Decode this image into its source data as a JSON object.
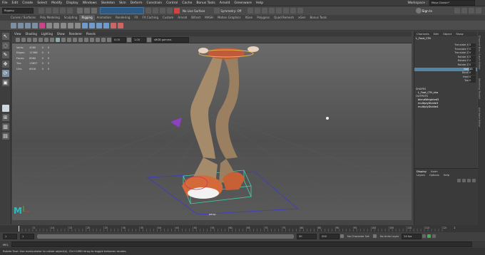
{
  "menubar": {
    "items": [
      "File",
      "Edit",
      "Create",
      "Select",
      "Modify",
      "Display",
      "Windows",
      "Skeleton",
      "Skin",
      "Deform",
      "Constrain",
      "Control",
      "Cache",
      "Bonus Tools",
      "Arnold",
      "Greenware",
      "Help"
    ],
    "workspace_label": "Workspace :",
    "workspace_value": "Maya Classic*"
  },
  "toolbar": {
    "mode_select": "Rigging",
    "no_live_surface": "No Live Surface",
    "symmetry": "Symmetry: Off",
    "sign_in": "Sign In",
    "search_placeholder": ""
  },
  "shelf_tabs": [
    "Curves / Surfaces",
    "Poly Modeling",
    "Sculpting",
    "Rigging",
    "Animation",
    "Rendering",
    "FX",
    "FX Caching",
    "Custom",
    "Arnold",
    "Bifrost",
    "MASH",
    "Motion Graphics",
    "XGen",
    "Polygons",
    "Quad Remesh",
    "xGen",
    "Bonus Tools"
  ],
  "shelf_active_index": 3,
  "viewport": {
    "menu": [
      "View",
      "Shading",
      "Lighting",
      "Show",
      "Renderer",
      "Panels"
    ],
    "near_value": "0.00",
    "far_value": "1.00",
    "color_space": "sRGB gamma",
    "camera_label": "persp",
    "hud": [
      {
        "label": "Verts:",
        "v1": "4560",
        "v2": "0",
        "v3": "0"
      },
      {
        "label": "Edges:",
        "v1": "11566",
        "v2": "0",
        "v3": "0"
      },
      {
        "label": "Faces:",
        "v1": "6560",
        "v2": "0",
        "v3": "0"
      },
      {
        "label": "Tris:",
        "v1": "13657",
        "v2": "0",
        "v3": "0"
      },
      {
        "label": "UVs:",
        "v1": "6916",
        "v2": "0",
        "v3": "0"
      }
    ]
  },
  "channel_box": {
    "tabs": [
      "Channels",
      "Edit",
      "Object",
      "Show"
    ],
    "object_name": "L_Foot_CTrl",
    "attributes": [
      {
        "name": "Translate X",
        "value": "0"
      },
      {
        "name": "Translate Y",
        "value": "0"
      },
      {
        "name": "Translate Z",
        "value": "0"
      },
      {
        "name": "Rotate X",
        "value": "0"
      },
      {
        "name": "Rotate Y",
        "value": "0"
      },
      {
        "name": "Rotate Z",
        "value": "0"
      },
      {
        "name": "Ball",
        "value": "10"
      },
      {
        "name": "Bank",
        "value": "0"
      },
      {
        "name": "Heel",
        "value": "0"
      },
      {
        "name": "Toe",
        "value": "0"
      }
    ],
    "selected_index": 6,
    "shapes_header": "SHAPES",
    "shape_name": "L_Foot_CTrl_sha",
    "outputs_header": "OUTPUTS",
    "outputs": [
      "blendWeighted3",
      "multiplyDivide3",
      "multiplyDivide4"
    ]
  },
  "layer_editor": {
    "tabs": [
      "Display",
      "Anim"
    ],
    "menu": [
      "Layers",
      "Options",
      "Help"
    ]
  },
  "side_tabs": [
    "Channel Box / Layer Editor",
    "Modeling Toolkit",
    "Attribute Editor"
  ],
  "timeline": {
    "start": "1",
    "end": "120",
    "range_start": "1",
    "range_end": "200",
    "current_frame_field": "1",
    "playback_start": "1",
    "playback_end": "30",
    "current_frame": "1",
    "character_set": "No Character Set",
    "anim_layer": "No Anim Layer",
    "fps": "24 fps",
    "ticks": [
      "5",
      "10",
      "15",
      "20",
      "25",
      "30",
      "35",
      "40",
      "45",
      "50",
      "55",
      "60",
      "65",
      "70",
      "75",
      "80",
      "85",
      "90",
      "95",
      "100",
      "105",
      "110",
      "115",
      "120"
    ]
  },
  "command_line": {
    "mel_label": "MEL"
  },
  "help_line": {
    "text": "Rotate Tool: Use manipulator to rotate object(s). Ctrl+LMB+drag to toggle between modes."
  },
  "colors": {
    "accent": "#5285a6",
    "shelf_active": "#5a5a5a",
    "character": "#a58b6a",
    "shoe": "#d46a3a",
    "ctrl": "#44d4a6"
  }
}
